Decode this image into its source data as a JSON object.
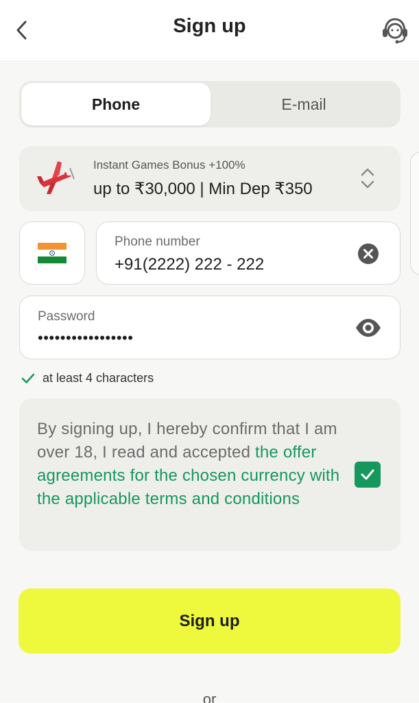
{
  "header": {
    "title": "Sign up",
    "back_icon": "chevron-left-icon",
    "support_icon": "headset-support-icon"
  },
  "tabs": [
    {
      "label": "Phone",
      "active": true
    },
    {
      "label": "E-mail",
      "active": false
    }
  ],
  "bonus": {
    "title": "Instant Games Bonus +100%",
    "amount": "up to ₹30,000 | Min Dep ₹350",
    "icon": "airplane-icon"
  },
  "country": {
    "flag": "india-flag-icon"
  },
  "phone": {
    "label": "Phone number",
    "value": "+91(2222) 222 - 222"
  },
  "password": {
    "label": "Password",
    "value": "•••••••••••••••••"
  },
  "hint": {
    "text": "at least 4 characters",
    "satisfied": true
  },
  "consent": {
    "text_plain": "By signing up, I hereby confirm that I am over 18, I read and accepted ",
    "link_text": "the offer agreements for the chosen currency with the applicable terms and conditions",
    "checked": true
  },
  "submit": {
    "label": "Sign up"
  },
  "divider": {
    "text": "or"
  },
  "colors": {
    "accent_green": "#16975e",
    "button_yellow": "#eef93e",
    "background": "#f7f7f5"
  }
}
